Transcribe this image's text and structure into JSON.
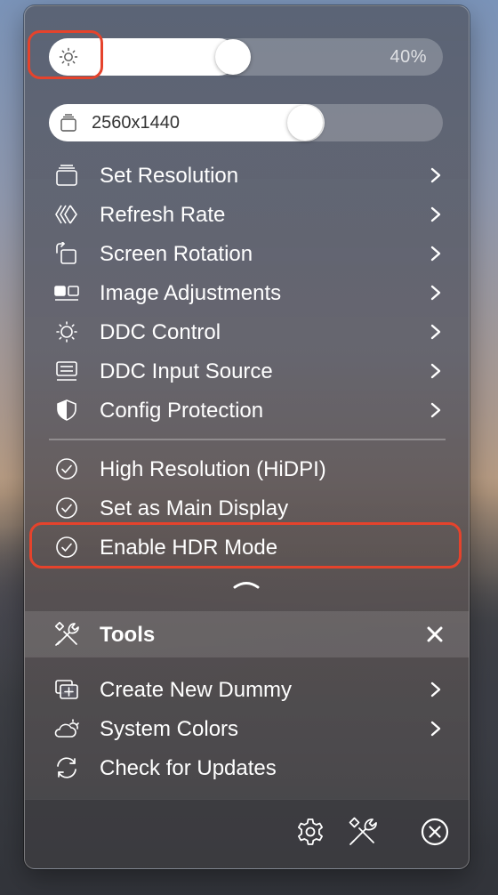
{
  "brightness": {
    "percent_label": "40%",
    "level": 0.4,
    "icon": "sun-icon"
  },
  "resolution_slider": {
    "value": "2560x1440",
    "icon": "display-stack-icon"
  },
  "menu": {
    "items": [
      {
        "label": "Set Resolution",
        "icon": "display-stack-icon",
        "submenu": true
      },
      {
        "label": "Refresh Rate",
        "icon": "refresh-rate-icon",
        "submenu": true
      },
      {
        "label": "Screen Rotation",
        "icon": "rotation-icon",
        "submenu": true
      },
      {
        "label": "Image Adjustments",
        "icon": "image-adjust-icon",
        "submenu": true
      },
      {
        "label": "DDC Control",
        "icon": "ddc-sun-icon",
        "submenu": true
      },
      {
        "label": "DDC Input Source",
        "icon": "input-source-icon",
        "submenu": true
      },
      {
        "label": "Config Protection",
        "icon": "shield-icon",
        "submenu": true
      }
    ],
    "toggles": [
      {
        "label": "High Resolution (HiDPI)",
        "icon": "check-circle-icon",
        "checked": true
      },
      {
        "label": "Set as Main Display",
        "icon": "check-circle-icon",
        "checked": true
      },
      {
        "label": "Enable HDR Mode",
        "icon": "check-circle-icon",
        "checked": true
      }
    ]
  },
  "tools": {
    "title": "Tools",
    "items": [
      {
        "label": "Create New Dummy",
        "icon": "add-display-icon",
        "submenu": true
      },
      {
        "label": "System Colors",
        "icon": "cloud-sun-icon",
        "submenu": true
      },
      {
        "label": "Check for Updates",
        "icon": "refresh-icon",
        "submenu": false
      }
    ]
  },
  "footer": {
    "icons": [
      "gear-icon",
      "tools-icon",
      "quit-icon"
    ]
  },
  "colors": {
    "highlight": "#e5432c",
    "text": "#ffffff",
    "slider_fill": "#ffffff"
  }
}
